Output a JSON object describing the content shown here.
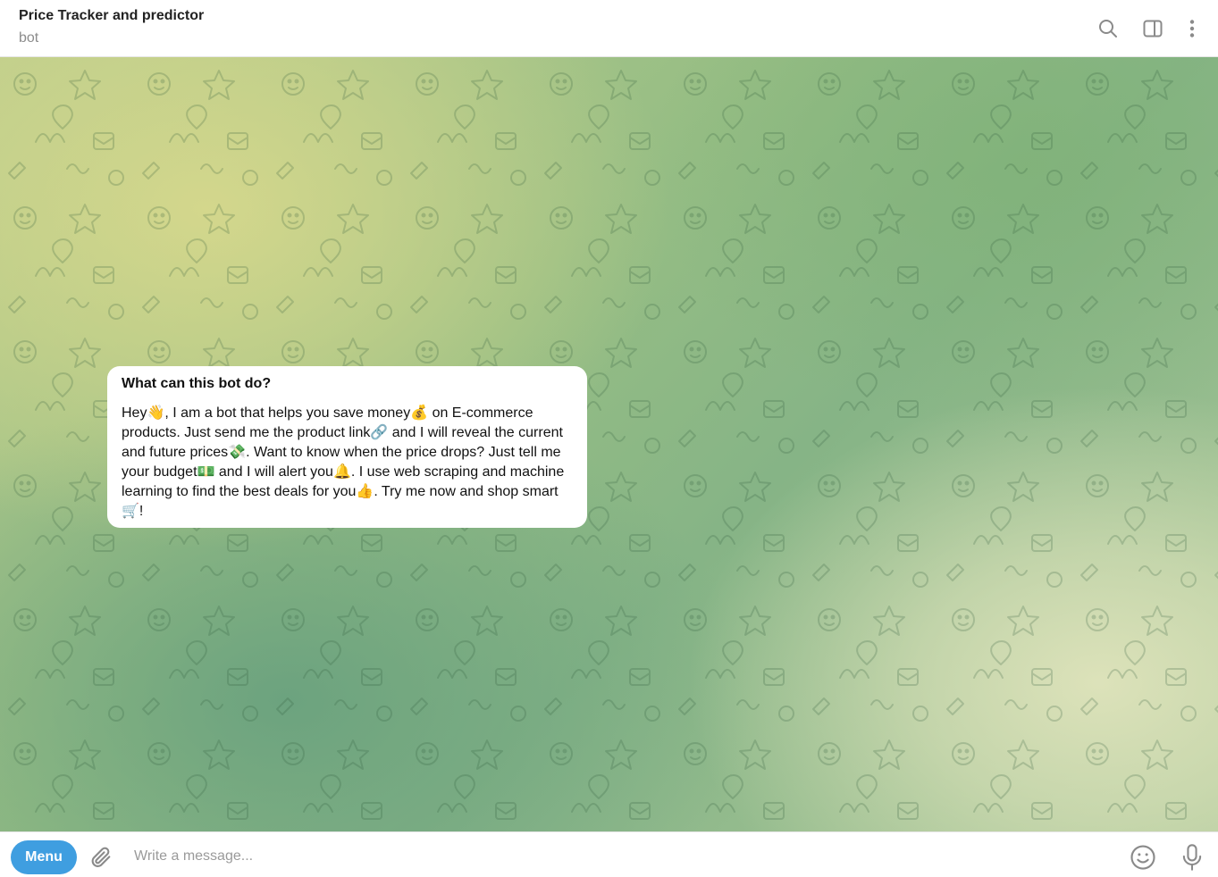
{
  "header": {
    "title": "Price Tracker and predictor",
    "subtitle": "bot",
    "icons": [
      "search-icon",
      "sidebar-toggle-icon",
      "more-vertical-icon"
    ]
  },
  "info_card": {
    "title": "What can this bot do?",
    "text": "Hey👋, I am a bot that helps you save money💰 on E-commerce products. Just send me the product link🔗 and I will reveal the current and future prices💸. Want to know when the price drops? Just tell me your budget💵 and I will alert you🔔. I use web scraping and machine learning to find the best deals for you👍. Try me now and shop smart🛒!"
  },
  "composer": {
    "menu_label": "Menu",
    "placeholder": "Write a message...",
    "value": "",
    "icons": [
      "paperclip-icon",
      "emoji-icon",
      "microphone-icon"
    ]
  },
  "colors": {
    "menu_button": "#3f9ee0",
    "background_yellow": "#d6d88c",
    "background_green": "#86b486",
    "icon_gray": "#8a8a8a"
  }
}
